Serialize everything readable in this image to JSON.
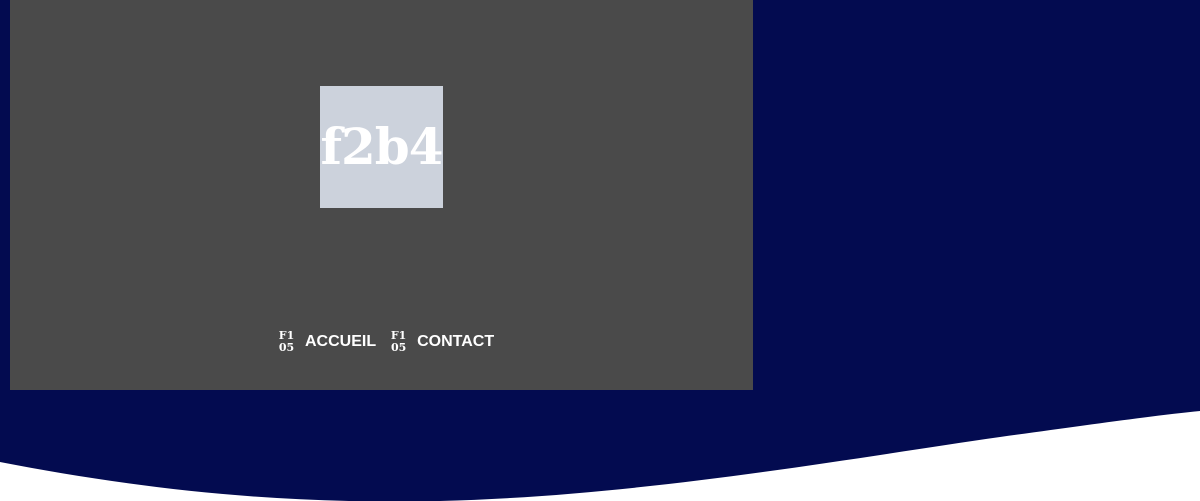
{
  "colors": {
    "background": "#030b50",
    "panel": "#4a4a4a",
    "icon_box": "#ccd2dc",
    "wave": "#ffffff",
    "text": "#ffffff"
  },
  "logo": {
    "text": "f2b4",
    "icon": "missing-glyph-icon"
  },
  "nav": {
    "items": [
      {
        "glyph_top": "F1",
        "glyph_bottom": "05",
        "icon": "missing-glyph-icon",
        "label": "ACCUEIL"
      },
      {
        "glyph_top": "F1",
        "glyph_bottom": "05",
        "icon": "missing-glyph-icon",
        "label": "CONTACT"
      }
    ]
  }
}
